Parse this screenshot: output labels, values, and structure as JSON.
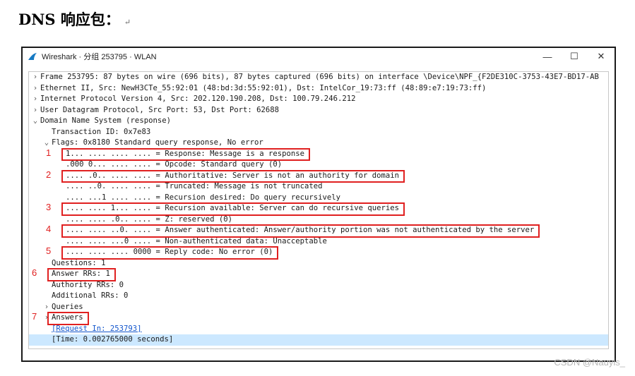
{
  "doc": {
    "heading": "DNS 响应包：",
    "return_mark": "↵"
  },
  "window": {
    "title": "Wireshark · 分组 253795 · WLAN",
    "controls": {
      "minimize": "—",
      "maximize": "☐",
      "close": "✕"
    }
  },
  "tree": [
    {
      "depth": 0,
      "arrow": "›",
      "text": "Frame 253795: 87 bytes on wire (696 bits), 87 bytes captured (696 bits) on interface \\Device\\NPF_{F2DE310C-3753-43E7-BD17-AB"
    },
    {
      "depth": 0,
      "arrow": "›",
      "text": "Ethernet II, Src: NewH3CTe_55:92:01 (48:bd:3d:55:92:01), Dst: IntelCor_19:73:ff (48:89:e7:19:73:ff)"
    },
    {
      "depth": 0,
      "arrow": "›",
      "text": "Internet Protocol Version 4, Src: 202.120.190.208, Dst: 100.79.246.212"
    },
    {
      "depth": 0,
      "arrow": "›",
      "text": "User Datagram Protocol, Src Port: 53, Dst Port: 62688"
    },
    {
      "depth": 0,
      "arrow": "⌄",
      "text": "Domain Name System (response)"
    },
    {
      "depth": 1,
      "arrow": "",
      "text": "Transaction ID: 0x7e83"
    },
    {
      "depth": 1,
      "arrow": "⌄",
      "text": "Flags: 0x8180 Standard query response, No error"
    },
    {
      "depth": 2,
      "arrow": "",
      "text": "1... .... .... .... = Response: Message is a response"
    },
    {
      "depth": 2,
      "arrow": "",
      "text": ".000 0... .... .... = Opcode: Standard query (0)"
    },
    {
      "depth": 2,
      "arrow": "",
      "text": ".... .0.. .... .... = Authoritative: Server is not an authority for domain"
    },
    {
      "depth": 2,
      "arrow": "",
      "text": ".... ..0. .... .... = Truncated: Message is not truncated"
    },
    {
      "depth": 2,
      "arrow": "",
      "text": ".... ...1 .... .... = Recursion desired: Do query recursively"
    },
    {
      "depth": 2,
      "arrow": "",
      "text": ".... .... 1... .... = Recursion available: Server can do recursive queries"
    },
    {
      "depth": 2,
      "arrow": "",
      "text": ".... .... .0.. .... = Z: reserved (0)"
    },
    {
      "depth": 2,
      "arrow": "",
      "text": ".... .... ..0. .... = Answer authenticated: Answer/authority portion was not authenticated by the server"
    },
    {
      "depth": 2,
      "arrow": "",
      "text": ".... .... ...0 .... = Non-authenticated data: Unacceptable"
    },
    {
      "depth": 2,
      "arrow": "",
      "text": ".... .... .... 0000 = Reply code: No error (0)"
    },
    {
      "depth": 1,
      "arrow": "",
      "text": "Questions: 1"
    },
    {
      "depth": 1,
      "arrow": "",
      "text": "Answer RRs: 1"
    },
    {
      "depth": 1,
      "arrow": "",
      "text": "Authority RRs: 0"
    },
    {
      "depth": 1,
      "arrow": "",
      "text": "Additional RRs: 0"
    },
    {
      "depth": 1,
      "arrow": "›",
      "text": "Queries"
    },
    {
      "depth": 1,
      "arrow": "›",
      "text": "Answers"
    },
    {
      "depth": 1,
      "arrow": "",
      "text": "[Request In: 253793]",
      "link": true
    },
    {
      "depth": 1,
      "arrow": "",
      "text": "[Time: 0.002765000 seconds]",
      "selected": true
    }
  ],
  "annotations": [
    {
      "label": "1",
      "row": 7
    },
    {
      "label": "2",
      "row": 9
    },
    {
      "label": "3",
      "row": 12
    },
    {
      "label": "4",
      "row": 14
    },
    {
      "label": "5",
      "row": 16
    },
    {
      "label": "6",
      "row": 18
    },
    {
      "label": "7",
      "row": 22
    }
  ],
  "watermark": "CSDN @Nauyis_"
}
